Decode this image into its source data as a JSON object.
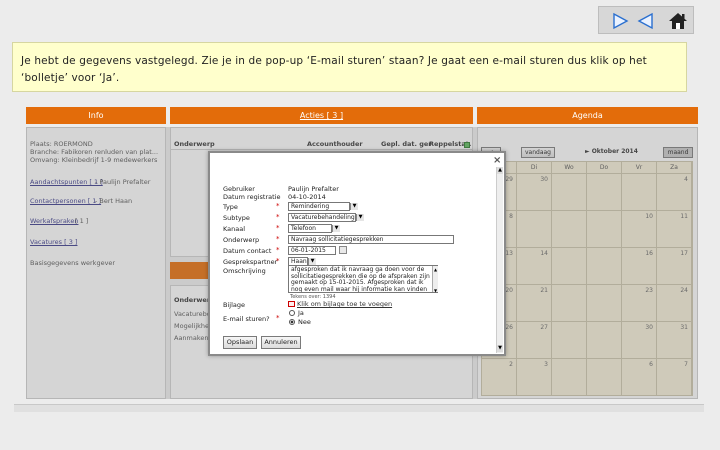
{
  "instruction": "Je hebt de gegevens vastgelegd. Zie je in de pop-up ‘E-mail sturen’ staan? Je gaat een e-mail sturen dus klik op het ‘bolletje’ voor ‘Ja’.",
  "panels": {
    "info_title": "Info",
    "acties_title": "Acties [ 3 ]",
    "agenda_title": "Agenda"
  },
  "info": {
    "plaats": "Plaats: ROERMOND",
    "branche": "Branche: Fabikoren renluden van plat...",
    "omvang": "Omvang: Kleinbedrijf 1-9 medewerkers",
    "aandachtspunten": "Aandachtspunten [ 1 ]",
    "aandachtspunten_who": "- Paulijn Prefalter",
    "contactpersonen": "Contactpersonen [ 1 ]",
    "contactpersonen_who": "- Bert Haan",
    "werkafspraken": "Werkafspraken",
    "werkafspraken_count": "[ 1 ]",
    "vacatures": "Vacatures [ 3 ]",
    "basisgegevens": "Basisgegevens werkgever"
  },
  "acties": {
    "headers": [
      "Onderwerp",
      "Accounthouder",
      "Gepl. dat. ger",
      "Reppelstat."
    ]
  },
  "lower": {
    "header": "Onderwerp",
    "rows": [
      "Vacaturebo",
      "Mogelijkhew",
      "Aanmaken w"
    ]
  },
  "agenda": {
    "vandaag": "vandaag",
    "month": "► Oktober 2014",
    "maand": "maand",
    "weekdays": [
      "Ma",
      "Di",
      "Wo",
      "Do",
      "Vr",
      "Za"
    ],
    "weeks": [
      [
        "29",
        "30",
        "",
        "",
        "",
        "4"
      ],
      [
        "8",
        "",
        "",
        "",
        "10",
        "11"
      ],
      [
        "13",
        "14",
        "",
        "",
        "16",
        "17"
      ],
      [
        "20",
        "21",
        "",
        "",
        "23",
        "24"
      ],
      [
        "26",
        "27",
        "",
        "",
        "30",
        "31"
      ],
      [
        "2",
        "3",
        "",
        "",
        "6",
        "7"
      ]
    ]
  },
  "modal": {
    "close": "×",
    "gebruiker_label": "Gebruiker",
    "gebruiker_value": "Paulijn Prefalter",
    "datum_reg_label": "Datum registratie",
    "datum_reg_value": "04-10-2014",
    "type_label": "Type",
    "type_value": "Remindering",
    "subtype_label": "Subtype",
    "subtype_value": "Vacaturebehandeling",
    "kanaal_label": "Kanaal",
    "kanaal_value": "Telefoon",
    "onderwerp_label": "Onderwerp",
    "onderwerp_value": "Navraag sollicitatiegesprekken",
    "datum_contact_label": "Datum contact",
    "datum_contact_value": "06-01-2015",
    "gesprekspartner_label": "Gesprekspartner",
    "gesprekspartner_value": "Haan",
    "omschrijving_label": "Omschrijving",
    "omschrijving_text": "afgesproken dat ik navraag ga doen voor de sollicitatiegesprekken die op de afspraken zijn gemaakt op 15-01-2015. Afgesproken dat ik nog even mail waar hij informatie kan vinden over proefplaatsingen.",
    "chars": "Tekens over: 1394",
    "bijlage_label": "Bijlage",
    "bijlage_link": "Klik om bijlage toe te voegen",
    "email_label": "E-mail sturen?",
    "opt_ja": "Ja",
    "opt_nee": "Nee",
    "opslaan": "Opslaan",
    "annuleren": "Annuleren"
  },
  "colors": {
    "accent": "#e36c0a",
    "instruction_bg": "#ffffcc",
    "calendar_bg": "#f1ead4",
    "required": "#cc0000"
  }
}
